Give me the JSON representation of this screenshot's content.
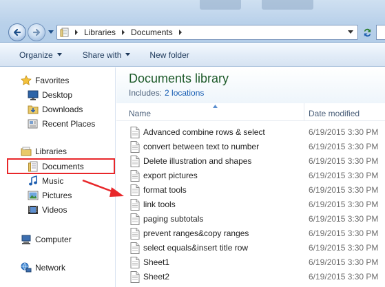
{
  "address_bar": {
    "crumbs": [
      "Libraries",
      "Documents"
    ]
  },
  "toolbar": {
    "organize_label": "Organize",
    "share_label": "Share with",
    "new_folder_label": "New folder"
  },
  "navigation": {
    "favorites_label": "Favorites",
    "desktop_label": "Desktop",
    "downloads_label": "Downloads",
    "recent_places_label": "Recent Places",
    "libraries_label": "Libraries",
    "documents_label": "Documents",
    "music_label": "Music",
    "pictures_label": "Pictures",
    "videos_label": "Videos",
    "computer_label": "Computer",
    "network_label": "Network"
  },
  "library": {
    "title": "Documents library",
    "includes_label": "Includes:",
    "locations_link": "2 locations"
  },
  "columns": {
    "name": "Name",
    "date_modified": "Date modified"
  },
  "files": [
    {
      "name": "Advanced combine rows & select",
      "date": "6/19/2015 3:30 PM"
    },
    {
      "name": "convert between text to number",
      "date": "6/19/2015 3:30 PM"
    },
    {
      "name": "Delete illustration and shapes",
      "date": "6/19/2015 3:30 PM"
    },
    {
      "name": "export pictures",
      "date": "6/19/2015 3:30 PM"
    },
    {
      "name": "format tools",
      "date": "6/19/2015 3:30 PM"
    },
    {
      "name": "link tools",
      "date": "6/19/2015 3:30 PM"
    },
    {
      "name": "paging subtotals",
      "date": "6/19/2015 3:30 PM"
    },
    {
      "name": "prevent ranges&copy ranges",
      "date": "6/19/2015 3:30 PM"
    },
    {
      "name": "select equals&insert title row",
      "date": "6/19/2015 3:30 PM"
    },
    {
      "name": "Sheet1",
      "date": "6/19/2015 3:30 PM"
    },
    {
      "name": "Sheet2",
      "date": "6/19/2015 3:30 PM"
    }
  ],
  "colors": {
    "highlight_box": "#e8272a",
    "annotation_arrow": "#e8272a",
    "library_title": "#1e5b2a",
    "link": "#1a5fb4"
  }
}
